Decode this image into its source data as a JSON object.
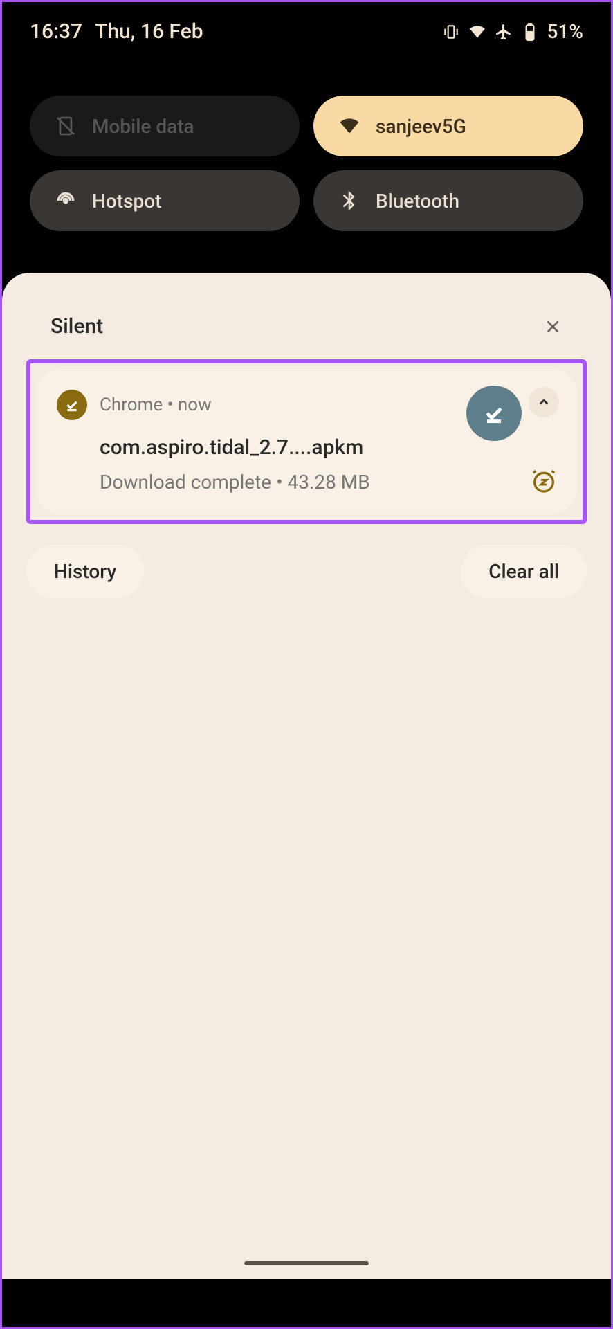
{
  "status": {
    "time": "16:37",
    "date": "Thu, 16 Feb",
    "battery": "51%"
  },
  "quickSettings": {
    "mobile_data": "Mobile data",
    "wifi": "sanjeev5G",
    "hotspot": "Hotspot",
    "bluetooth": "Bluetooth"
  },
  "notifications": {
    "section_title": "Silent",
    "card": {
      "app": "Chrome",
      "time_sep": " • ",
      "time": "now",
      "title": "com.aspiro.tidal_2.7....apkm",
      "subtitle": "Download complete • 43.28 MB"
    }
  },
  "actions": {
    "history": "History",
    "clear_all": "Clear all"
  }
}
